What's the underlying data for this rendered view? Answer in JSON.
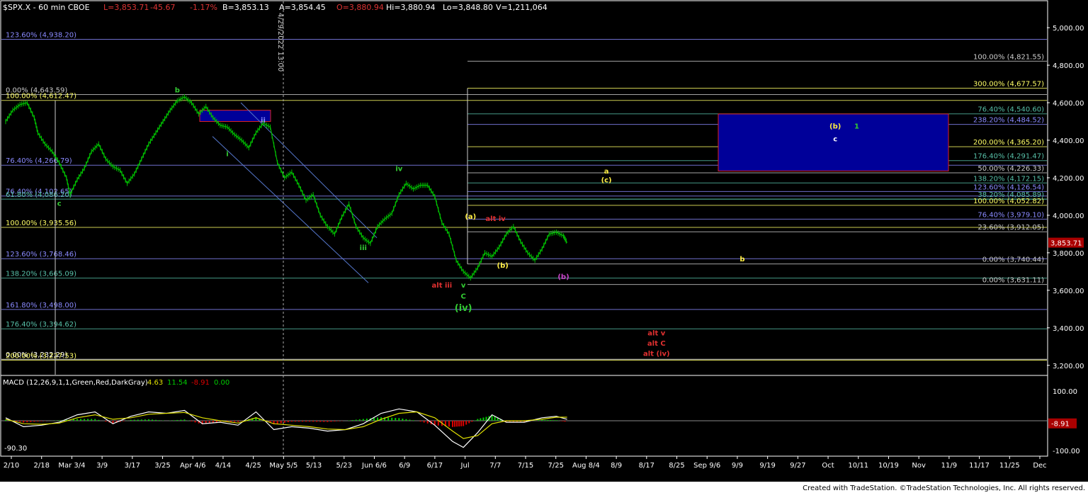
{
  "colors": {
    "background": "#000000",
    "frame": "#ffffff",
    "grid": "#555555",
    "price_bar": "#00c000",
    "macd_up": "#00cc00",
    "macd_down": "#dd0000",
    "signal": "#e0e000",
    "fib_blue": "#8a8aff",
    "fib_yellow": "#ffff66",
    "fib_teal": "#57c0a8",
    "wave_green": "#33cc33",
    "wave_red": "#e03030",
    "wave_yellow": "#ffee44",
    "wave_magenta": "#cc44cc",
    "box_fill": "#000099",
    "box_border": "#dd2222",
    "last_price_bg": "#aa0000"
  },
  "header": {
    "symbol": "$SPX.X - 60 min  CBOE",
    "last": "L=3,853.71",
    "change": "-45.67",
    "change_pct": "-1.17%",
    "bid": "B=3,853.13",
    "ask": "A=3,854.45",
    "open": "O=3,880.94",
    "high": "Hi=3,880.94",
    "low": "Lo=3,848.80",
    "volume": "V=1,211,064"
  },
  "vertical_marker_label": "4/29/2022 13:00",
  "footer": {
    "credit": "Created with TradeStation. ©TradeStation Technologies, Inc. All rights reserved."
  },
  "chart_data": [
    {
      "type": "bar",
      "name": "price-panel",
      "x_ticks": [
        "2/10",
        "2/18",
        "Mar 3/4",
        "3/9",
        "3/17",
        "3/25",
        "Apr 4/6",
        "4/14",
        "4/25",
        "May 5/5",
        "5/13",
        "5/23",
        "Jun 6/6",
        "6/9",
        "6/17",
        "Jul",
        "7/7",
        "7/15",
        "7/25",
        "Aug 8/4",
        "8/9",
        "8/17",
        "8/25",
        "Sep 9/6",
        "9/9",
        "9/19",
        "9/27",
        "Oct",
        "10/11",
        "10/19",
        "Nov",
        "11/9",
        "11/17",
        "11/25",
        "Dec"
      ],
      "y_ticks": [
        "5,000.00",
        "4,800.00",
        "4,600.00",
        "4,400.00",
        "4,200.00",
        "4,000.00",
        "3,800.00",
        "3,600.00",
        "3,400.00",
        "3,200.00"
      ],
      "ylim": [
        3150,
        5140
      ],
      "last_price_label": "3,853.71",
      "price_path": [
        [
          0,
          4500
        ],
        [
          2,
          4560
        ],
        [
          4,
          4590
        ],
        [
          6,
          4600
        ],
        [
          8,
          4520
        ],
        [
          9,
          4440
        ],
        [
          11,
          4380
        ],
        [
          13,
          4340
        ],
        [
          15,
          4280
        ],
        [
          17,
          4200
        ],
        [
          18,
          4110
        ],
        [
          20,
          4190
        ],
        [
          22,
          4250
        ],
        [
          24,
          4340
        ],
        [
          26,
          4380
        ],
        [
          28,
          4300
        ],
        [
          30,
          4260
        ],
        [
          32,
          4240
        ],
        [
          34,
          4170
        ],
        [
          36,
          4220
        ],
        [
          38,
          4300
        ],
        [
          40,
          4380
        ],
        [
          42,
          4440
        ],
        [
          44,
          4500
        ],
        [
          46,
          4560
        ],
        [
          48,
          4610
        ],
        [
          50,
          4631
        ],
        [
          52,
          4600
        ],
        [
          54,
          4540
        ],
        [
          56,
          4580
        ],
        [
          58,
          4520
        ],
        [
          60,
          4480
        ],
        [
          62,
          4470
        ],
        [
          64,
          4430
        ],
        [
          66,
          4400
        ],
        [
          68,
          4360
        ],
        [
          70,
          4440
        ],
        [
          72,
          4490
        ],
        [
          74,
          4470
        ],
        [
          76,
          4280
        ],
        [
          78,
          4200
        ],
        [
          80,
          4230
        ],
        [
          82,
          4160
        ],
        [
          84,
          4080
        ],
        [
          86,
          4110
        ],
        [
          88,
          4000
        ],
        [
          90,
          3940
        ],
        [
          92,
          3900
        ],
        [
          94,
          3990
        ],
        [
          96,
          4060
        ],
        [
          98,
          3940
        ],
        [
          100,
          3880
        ],
        [
          102,
          3850
        ],
        [
          104,
          3940
        ],
        [
          106,
          3980
        ],
        [
          108,
          4010
        ],
        [
          110,
          4110
        ],
        [
          112,
          4170
        ],
        [
          114,
          4140
        ],
        [
          116,
          4160
        ],
        [
          118,
          4160
        ],
        [
          120,
          4100
        ],
        [
          122,
          3960
        ],
        [
          124,
          3900
        ],
        [
          126,
          3760
        ],
        [
          128,
          3700
        ],
        [
          130,
          3666
        ],
        [
          132,
          3720
        ],
        [
          134,
          3800
        ],
        [
          136,
          3780
        ],
        [
          138,
          3830
        ],
        [
          140,
          3900
        ],
        [
          142,
          3940
        ],
        [
          144,
          3860
        ],
        [
          146,
          3800
        ],
        [
          148,
          3760
        ],
        [
          150,
          3820
        ],
        [
          152,
          3900
        ],
        [
          154,
          3910
        ],
        [
          156,
          3890
        ],
        [
          157,
          3854
        ]
      ],
      "fib_levels": [
        {
          "label": "123.60% (4,938.20)",
          "value": 4938.2,
          "color": "#8a8aff",
          "side": "left"
        },
        {
          "label": "100.00% (4,821.55)",
          "value": 4821.55,
          "color": "#cccccc",
          "side": "right"
        },
        {
          "label": "300.00% (4,677.57)",
          "value": 4677.57,
          "color": "#ffff66",
          "side": "right"
        },
        {
          "label": "0.00% (4,643.59)",
          "value": 4643.59,
          "color": "#cccccc",
          "side": "left"
        },
        {
          "label": "100.00% (4,612.47)",
          "value": 4612.47,
          "color": "#ffff66",
          "side": "left"
        },
        {
          "label": "76.40% (4,540.60)",
          "value": 4540.6,
          "color": "#57c0a8",
          "side": "right"
        },
        {
          "label": "238.20% (4,484.52)",
          "value": 4484.52,
          "color": "#8a8aff",
          "side": "right"
        },
        {
          "label": "200.00% (4,365.20)",
          "value": 4365.2,
          "color": "#ffff66",
          "side": "right"
        },
        {
          "label": "176.40% (4,291.47)",
          "value": 4291.47,
          "color": "#57c0a8",
          "side": "right"
        },
        {
          "label": "76.40% (4,266.79)",
          "value": 4266.79,
          "color": "#8a8aff",
          "side": "left"
        },
        {
          "label": "50.00% (4,226.33)",
          "value": 4226.33,
          "color": "#cccccc",
          "side": "right"
        },
        {
          "label": "138.20% (4,172.15)",
          "value": 4172.15,
          "color": "#57c0a8",
          "side": "right"
        },
        {
          "label": "123.60% (4,126.54)",
          "value": 4126.54,
          "color": "#8a8aff",
          "side": "right"
        },
        {
          "label": "76.40% (4,102.65)",
          "value": 4102.65,
          "color": "#8a8aff",
          "side": "left"
        },
        {
          "label": "38.20% (4,085.89)",
          "value": 4085.89,
          "color": "#57c0a8",
          "side": "right"
        },
        {
          "label": "61.80% (4,086.20)",
          "value": 4086.2,
          "color": "#57c0a8",
          "side": "left"
        },
        {
          "label": "100.00% (4,052.82)",
          "value": 4052.82,
          "color": "#ffff66",
          "side": "right"
        },
        {
          "label": "76.40% (3,979.10)",
          "value": 3979.1,
          "color": "#8a8aff",
          "side": "right"
        },
        {
          "label": "100.00% (3,935.56)",
          "value": 3935.56,
          "color": "#ffff66",
          "side": "left"
        },
        {
          "label": "23.60% (3,912.05)",
          "value": 3912.05,
          "color": "#cccccc",
          "side": "right"
        },
        {
          "label": "123.60% (3,768.46)",
          "value": 3768.46,
          "color": "#8a8aff",
          "side": "left"
        },
        {
          "label": "0.00% (3,740.44)",
          "value": 3740.44,
          "color": "#cccccc",
          "side": "right"
        },
        {
          "label": "138.20% (3,665.09)",
          "value": 3665.09,
          "color": "#57c0a8",
          "side": "left"
        },
        {
          "label": "0.00% (3,631.11)",
          "value": 3631.11,
          "color": "#cccccc",
          "side": "right"
        },
        {
          "label": "161.80% (3,498.00)",
          "value": 3498.0,
          "color": "#8a8aff",
          "side": "left"
        },
        {
          "label": "176.40% (3,394.62)",
          "value": 3394.62,
          "color": "#57c0a8",
          "side": "left"
        },
        {
          "label": "0.00% (3,232.29)",
          "value": 3232.29,
          "color": "#ffffff",
          "side": "left"
        },
        {
          "label": "200.00% (3,227.53)",
          "value": 3227.53,
          "color": "#ffff66",
          "side": "left"
        }
      ],
      "wave_labels": [
        {
          "text": "b",
          "color": "#33cc33",
          "x": 48,
          "y": 4655
        },
        {
          "text": "ii",
          "color": "#8a8aff",
          "x": 72,
          "y": 4495
        },
        {
          "text": "i",
          "color": "#33cc33",
          "x": 62,
          "y": 4315
        },
        {
          "text": "c",
          "color": "#33cc33",
          "x": 15,
          "y": 4050
        },
        {
          "text": "iii",
          "color": "#33cc33",
          "x": 100,
          "y": 3815
        },
        {
          "text": "iv",
          "color": "#33cc33",
          "x": 110,
          "y": 4235
        },
        {
          "text": "(a)",
          "color": "#ffee44",
          "x": 130,
          "y": 3980
        },
        {
          "text": "alt iv",
          "color": "#e03030",
          "x": 137,
          "y": 3970
        },
        {
          "text": "(b)",
          "color": "#ffee44",
          "x": 139,
          "y": 3720
        },
        {
          "text": "alt iii",
          "color": "#e03030",
          "x": 122,
          "y": 3615
        },
        {
          "text": "v",
          "color": "#33cc33",
          "x": 128,
          "y": 3615
        },
        {
          "text": "C",
          "color": "#33cc33",
          "x": 128,
          "y": 3555
        },
        {
          "text": "(iv)",
          "color": "#33cc33",
          "x": 128,
          "y": 3490
        },
        {
          "text": "a",
          "color": "#ffee44",
          "x": 168,
          "y": 4222
        },
        {
          "text": "(c)",
          "color": "#ffee44",
          "x": 168,
          "y": 4175
        },
        {
          "text": "(b)",
          "color": "#ffee44",
          "x": 232,
          "y": 4462
        },
        {
          "text": "1",
          "color": "#33cc33",
          "x": 238,
          "y": 4462
        },
        {
          "text": "c",
          "color": "#ffffff",
          "x": 232,
          "y": 4395
        },
        {
          "text": "b",
          "color": "#ffee44",
          "x": 206,
          "y": 3755
        },
        {
          "text": "(b)",
          "color": "#cc44cc",
          "x": 156,
          "y": 3660
        },
        {
          "text": "alt v",
          "color": "#e03030",
          "x": 182,
          "y": 3360
        },
        {
          "text": "alt C",
          "color": "#e03030",
          "x": 182,
          "y": 3305
        },
        {
          "text": "alt (iv)",
          "color": "#e03030",
          "x": 182,
          "y": 3250
        }
      ]
    },
    {
      "type": "line",
      "name": "macd-panel",
      "title": "MACD (12,26,9,1,1,Green,Red,DarkGray)",
      "readout_macd": "4.63",
      "readout_signal": "11.54",
      "readout_diff": "-8.91",
      "readout_zero": "0.00",
      "y_ticks": [
        "100.00",
        "-100.00"
      ],
      "ylim": [
        -110,
        110
      ],
      "lowest_label": "-90.30",
      "last_label": "-8.91",
      "macd_line": [
        [
          0,
          10
        ],
        [
          5,
          -20
        ],
        [
          10,
          -15
        ],
        [
          15,
          -5
        ],
        [
          20,
          20
        ],
        [
          25,
          30
        ],
        [
          30,
          -10
        ],
        [
          35,
          15
        ],
        [
          40,
          30
        ],
        [
          45,
          25
        ],
        [
          50,
          35
        ],
        [
          55,
          -10
        ],
        [
          60,
          -5
        ],
        [
          65,
          -15
        ],
        [
          70,
          30
        ],
        [
          75,
          -30
        ],
        [
          80,
          -20
        ],
        [
          85,
          -25
        ],
        [
          90,
          -35
        ],
        [
          95,
          -30
        ],
        [
          100,
          -10
        ],
        [
          105,
          25
        ],
        [
          110,
          40
        ],
        [
          115,
          30
        ],
        [
          120,
          -15
        ],
        [
          125,
          -70
        ],
        [
          128,
          -90
        ],
        [
          132,
          -40
        ],
        [
          136,
          20
        ],
        [
          140,
          -5
        ],
        [
          145,
          -5
        ],
        [
          150,
          10
        ],
        [
          154,
          15
        ],
        [
          157,
          5
        ]
      ],
      "signal_line": [
        [
          0,
          5
        ],
        [
          5,
          -10
        ],
        [
          10,
          -12
        ],
        [
          15,
          -8
        ],
        [
          20,
          10
        ],
        [
          25,
          20
        ],
        [
          30,
          5
        ],
        [
          35,
          10
        ],
        [
          40,
          22
        ],
        [
          45,
          25
        ],
        [
          50,
          28
        ],
        [
          55,
          10
        ],
        [
          60,
          0
        ],
        [
          65,
          -8
        ],
        [
          70,
          10
        ],
        [
          75,
          -10
        ],
        [
          80,
          -15
        ],
        [
          85,
          -20
        ],
        [
          90,
          -28
        ],
        [
          95,
          -30
        ],
        [
          100,
          -20
        ],
        [
          105,
          5
        ],
        [
          110,
          25
        ],
        [
          115,
          30
        ],
        [
          120,
          10
        ],
        [
          125,
          -35
        ],
        [
          128,
          -60
        ],
        [
          132,
          -50
        ],
        [
          136,
          -10
        ],
        [
          140,
          0
        ],
        [
          145,
          0
        ],
        [
          150,
          5
        ],
        [
          154,
          12
        ],
        [
          157,
          12
        ]
      ]
    }
  ]
}
